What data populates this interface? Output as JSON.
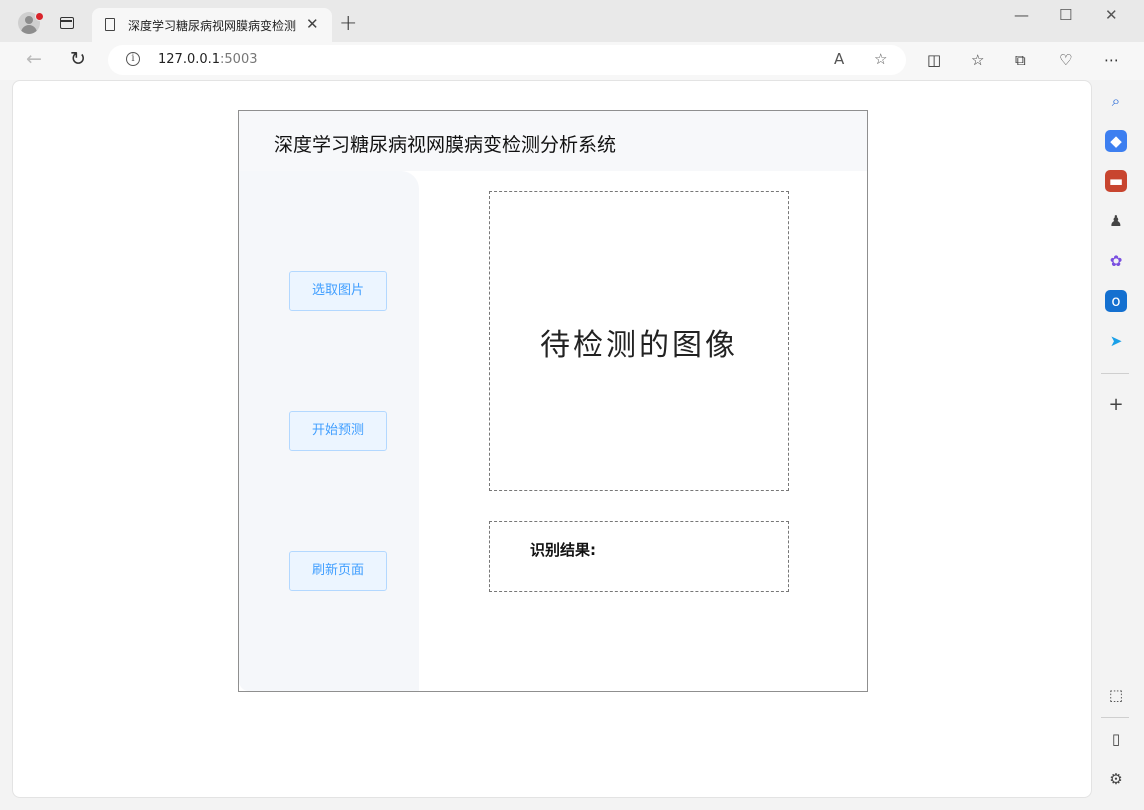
{
  "browser": {
    "tab_title": "深度学习糖尿病视网膜病变检测分析系统",
    "tab_close": "✕",
    "new_tab": "+",
    "address": {
      "host": "127.0.0.1",
      "port": ":5003"
    },
    "window_controls": [
      "—",
      "☐",
      "✕"
    ]
  },
  "app": {
    "title": "深度学习糖尿病视网膜病变检测分析系统",
    "buttons": {
      "select_image": "选取图片",
      "start_predict": "开始预测",
      "refresh_page": "刷新页面"
    },
    "image_placeholder": "待检测的图像",
    "result_label": "识别结果:"
  },
  "colors": {
    "button_text": "#409eff",
    "button_bg": "#ecf5ff",
    "button_border": "#b3d8ff",
    "sidebar_bg": "#f5f7fa"
  },
  "icons": {
    "sidebar": [
      "search-icon",
      "tag-icon",
      "toolbox-icon",
      "chess-icon",
      "copilot-icon",
      "outlook-icon",
      "send-icon",
      "add-icon",
      "screenshot-icon",
      "sidebar-toggle-icon",
      "settings-icon"
    ]
  }
}
